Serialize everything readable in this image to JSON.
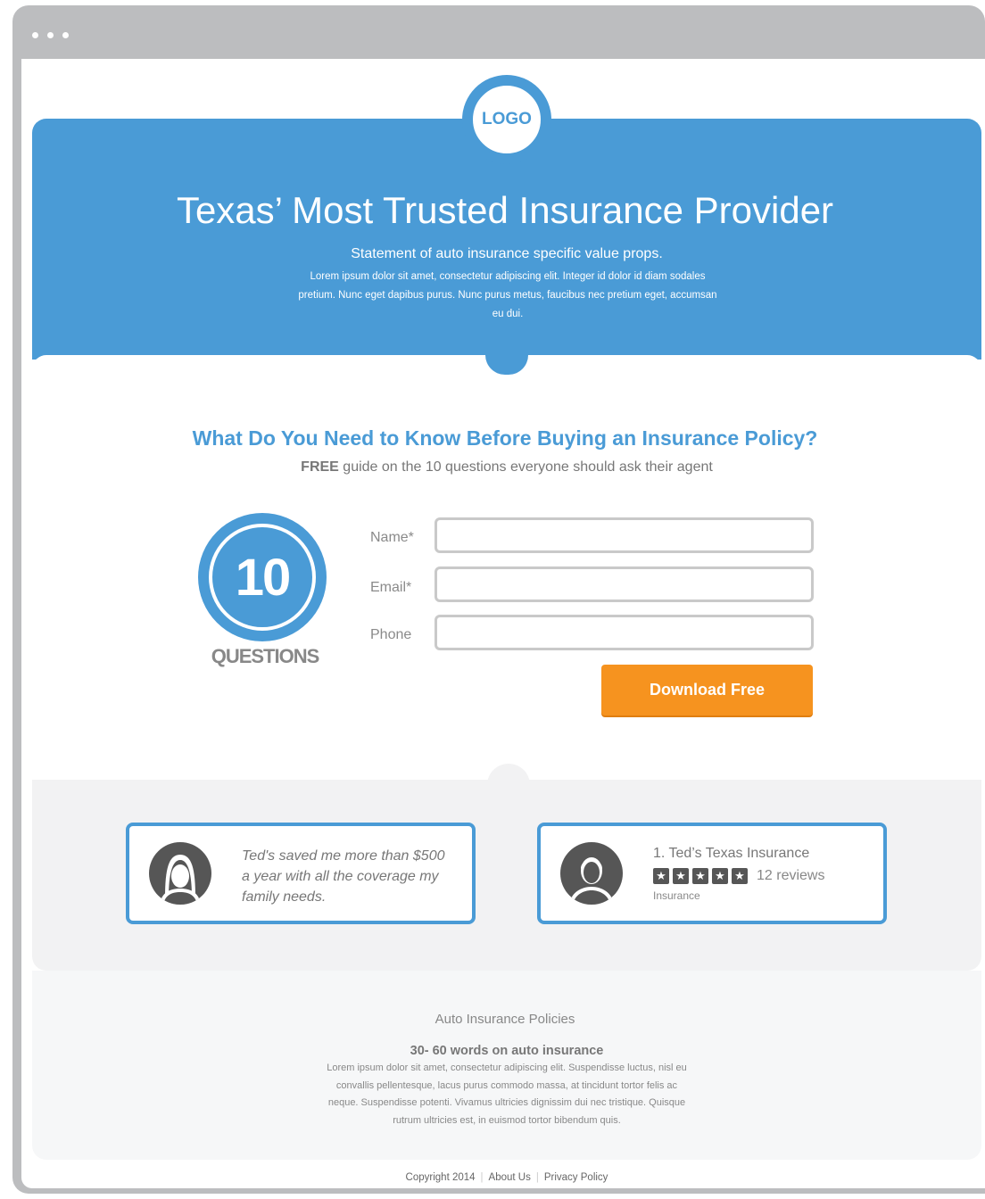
{
  "logo": {
    "text": "LOGO"
  },
  "hero": {
    "title": "Texas’ Most Trusted Insurance Provider",
    "subtitle": "Statement of auto insurance specific value props.",
    "body": "Lorem ipsum dolor sit amet, consectetur adipiscing elit. Integer id dolor id diam sodales pretium. Nunc eget dapibus purus. Nunc purus metus, faucibus nec pretium eget, accumsan eu dui."
  },
  "offer": {
    "title": "What Do You Need to Know Before Buying an Insurance Policy?",
    "sub_bold": "FREE",
    "sub_rest": " guide on the 10 questions everyone should ask their agent",
    "badge_number": "10",
    "badge_label": "QUESTIONS"
  },
  "form": {
    "name_label": "Name*",
    "email_label": "Email*",
    "phone_label": "Phone",
    "name_value": "",
    "email_value": "",
    "phone_value": "",
    "submit_label": "Download Free"
  },
  "testimonial": {
    "quote": "Ted's saved me more than $500 a year with all the coverage my family needs."
  },
  "review_listing": {
    "name": "1. Ted’s Texas Insurance",
    "stars": 5,
    "reviews": "12 reviews",
    "category": "Insurance"
  },
  "policies": {
    "title": "Auto Insurance Policies",
    "heading": "30- 60 words on auto insurance",
    "body": "Lorem ipsum dolor sit amet, consectetur adipiscing elit. Suspendisse luctus, nisl eu convallis pellentesque, lacus purus commodo massa, at tincidunt tortor felis ac neque. Suspendisse potenti. Vivamus ultricies dignissim dui nec tristique. Quisque rutrum ultricies est, in euismod tortor bibendum quis."
  },
  "footer": {
    "copyright": "Copyright 2014",
    "about": "About Us",
    "privacy": "Privacy Policy"
  },
  "colors": {
    "brand_blue": "#4a9bd6",
    "cta_orange": "#f6931f",
    "frame_gray": "#bcbdbf"
  }
}
